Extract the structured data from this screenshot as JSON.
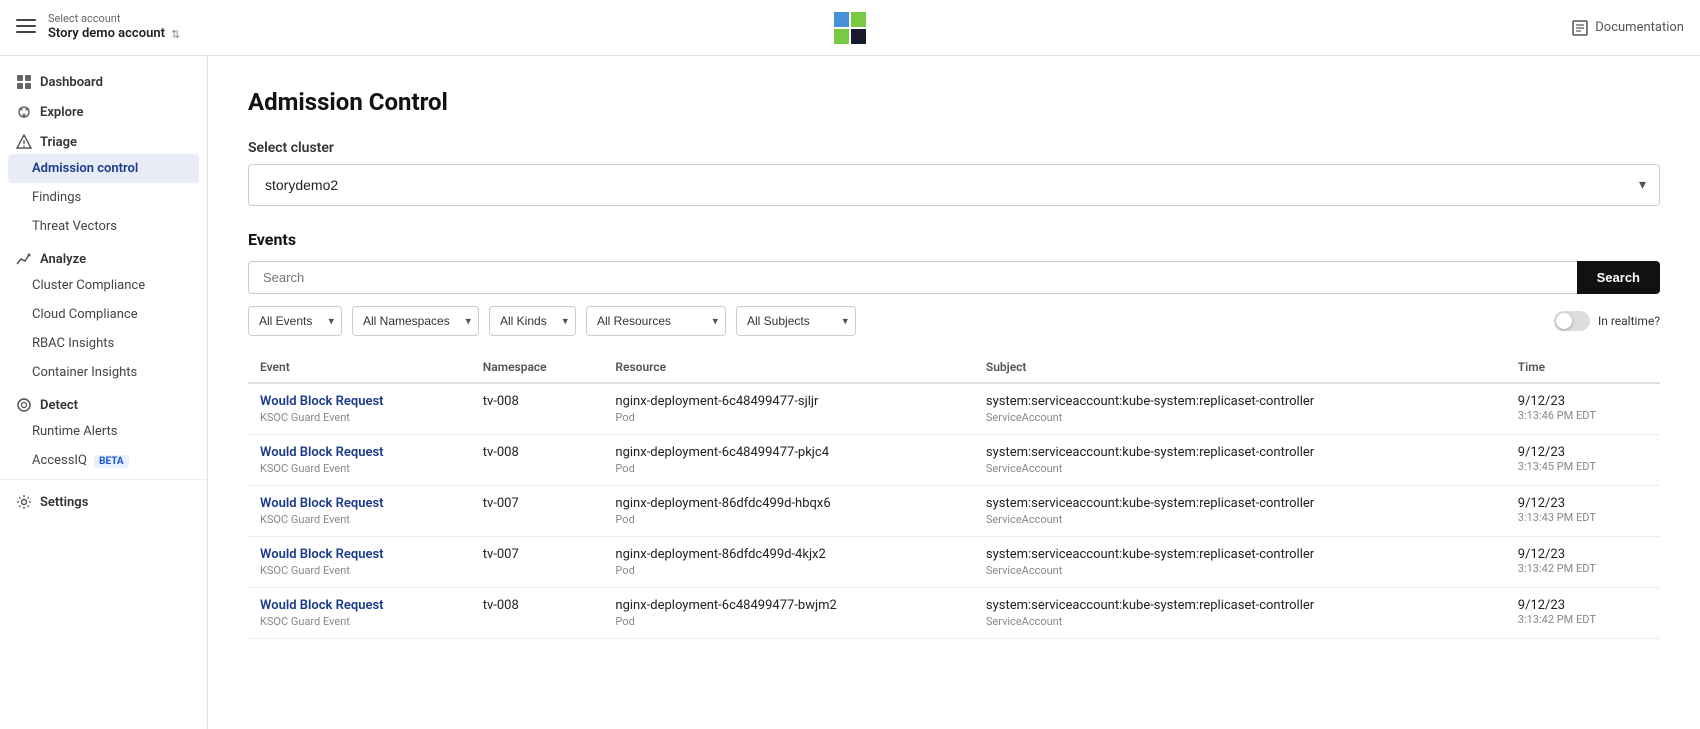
{
  "topbar": {
    "menu_icon": "☰",
    "account_select_label": "Select account",
    "account_name": "Story demo account",
    "docs_label": "Documentation",
    "docs_icon": "📖"
  },
  "logo": {
    "cells": [
      "tl",
      "tr",
      "bl",
      "br"
    ]
  },
  "sidebar": {
    "dashboard_label": "Dashboard",
    "explore_label": "Explore",
    "triage_label": "Triage",
    "triage_items": [
      {
        "label": "Admission control",
        "active": true
      },
      {
        "label": "Findings",
        "active": false
      },
      {
        "label": "Threat Vectors",
        "active": false
      }
    ],
    "analyze_label": "Analyze",
    "analyze_items": [
      {
        "label": "Cluster Compliance",
        "active": false
      },
      {
        "label": "Cloud Compliance",
        "active": false
      },
      {
        "label": "RBAC Insights",
        "active": false
      },
      {
        "label": "Container Insights",
        "active": false
      }
    ],
    "detect_label": "Detect",
    "detect_items": [
      {
        "label": "Runtime Alerts",
        "active": false
      },
      {
        "label": "AccessIQ",
        "beta": true,
        "active": false
      }
    ],
    "settings_label": "Settings"
  },
  "main": {
    "page_title": "Admission Control",
    "select_cluster_label": "Select cluster",
    "cluster_value": "storydemo2",
    "cluster_options": [
      "storydemo2"
    ],
    "events_title": "Events",
    "search_placeholder": "Search",
    "search_btn_label": "Search",
    "filters": {
      "events": {
        "value": "All Events",
        "options": [
          "All Events"
        ]
      },
      "namespaces": {
        "value": "All Namespaces",
        "options": [
          "All Namespaces"
        ]
      },
      "kinds": {
        "value": "All Kinds",
        "options": [
          "All Kinds"
        ]
      },
      "resources": {
        "value": "All Resources",
        "options": [
          "All Resources"
        ]
      },
      "subjects": {
        "value": "All Subjects",
        "options": [
          "All Subjects"
        ]
      }
    },
    "realtime_label": "In realtime?",
    "table_headers": [
      "Event",
      "Namespace",
      "Resource",
      "Subject",
      "Time"
    ],
    "table_rows": [
      {
        "event_name": "Would Block Request",
        "event_sub": "KSOC Guard Event",
        "namespace": "tv-008",
        "resource_name": "nginx-deployment-6c48499477-sjljr",
        "resource_kind": "Pod",
        "subject_name": "system:serviceaccount:kube-system:replicaset-controller",
        "subject_kind": "ServiceAccount",
        "time_main": "9/12/23",
        "time_sub": "3:13:46 PM EDT"
      },
      {
        "event_name": "Would Block Request",
        "event_sub": "KSOC Guard Event",
        "namespace": "tv-008",
        "resource_name": "nginx-deployment-6c48499477-pkjc4",
        "resource_kind": "Pod",
        "subject_name": "system:serviceaccount:kube-system:replicaset-controller",
        "subject_kind": "ServiceAccount",
        "time_main": "9/12/23",
        "time_sub": "3:13:45 PM EDT"
      },
      {
        "event_name": "Would Block Request",
        "event_sub": "KSOC Guard Event",
        "namespace": "tv-007",
        "resource_name": "nginx-deployment-86dfdc499d-hbqx6",
        "resource_kind": "Pod",
        "subject_name": "system:serviceaccount:kube-system:replicaset-controller",
        "subject_kind": "ServiceAccount",
        "time_main": "9/12/23",
        "time_sub": "3:13:43 PM EDT"
      },
      {
        "event_name": "Would Block Request",
        "event_sub": "KSOC Guard Event",
        "namespace": "tv-007",
        "resource_name": "nginx-deployment-86dfdc499d-4kjx2",
        "resource_kind": "Pod",
        "subject_name": "system:serviceaccount:kube-system:replicaset-controller",
        "subject_kind": "ServiceAccount",
        "time_main": "9/12/23",
        "time_sub": "3:13:42 PM EDT"
      },
      {
        "event_name": "Would Block Request",
        "event_sub": "KSOC Guard Event",
        "namespace": "tv-008",
        "resource_name": "nginx-deployment-6c48499477-bwjm2",
        "resource_kind": "Pod",
        "subject_name": "system:serviceaccount:kube-system:replicaset-controller",
        "subject_kind": "ServiceAccount",
        "time_main": "9/12/23",
        "time_sub": "3:13:42 PM EDT"
      }
    ]
  }
}
